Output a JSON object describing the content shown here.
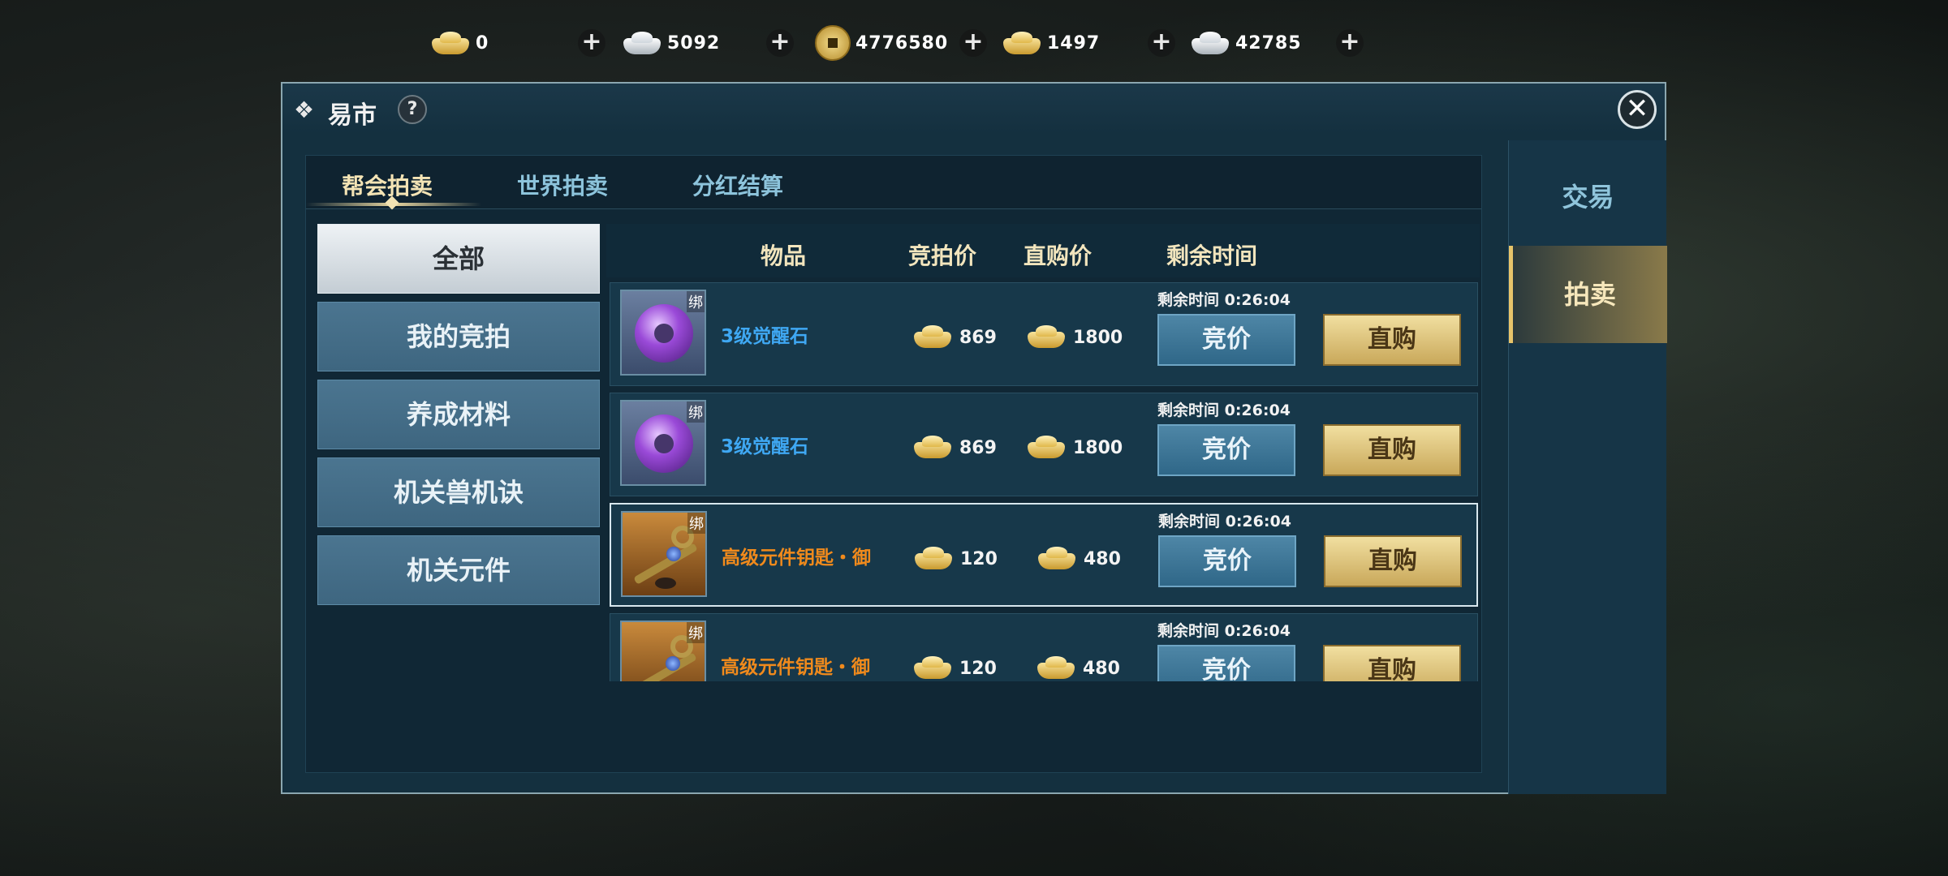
{
  "currencies": [
    {
      "type": "gold-ingot",
      "amount": "0"
    },
    {
      "type": "silver-ingot",
      "amount": "5092"
    },
    {
      "type": "copper-coin",
      "amount": "4776580"
    },
    {
      "type": "gold-ingot-small",
      "amount": "1497"
    },
    {
      "type": "silver-ingot-large",
      "amount": "42785"
    }
  ],
  "currency_plus": "+",
  "window": {
    "title": "易市",
    "help": "?",
    "close": "✕"
  },
  "tabs": [
    "帮会拍卖",
    "世界拍卖",
    "分红结算"
  ],
  "categories": [
    "全部",
    "我的竞拍",
    "养成材料",
    "机关兽机诀",
    "机关元件"
  ],
  "table_headers": {
    "item": "物品",
    "bid_price": "竞拍价",
    "buy_price": "直购价",
    "time_left": "剩余时间"
  },
  "rows": [
    {
      "name": "3级觉醒石",
      "icon": "awakening-stone",
      "bind": "绑",
      "bid": "869",
      "buy": "1800",
      "timer": "剩余时间  0:26:04",
      "bid_label": "竞价",
      "buy_label": "直购"
    },
    {
      "name": "3级觉醒石",
      "icon": "awakening-stone",
      "bind": "绑",
      "bid": "869",
      "buy": "1800",
      "timer": "剩余时间  0:26:04",
      "bid_label": "竞价",
      "buy_label": "直购"
    },
    {
      "name": "高级元件钥匙・御",
      "icon": "component-key",
      "bind": "绑",
      "bid": "120",
      "buy": "480",
      "timer": "剩余时间  0:26:04",
      "bid_label": "竞价",
      "buy_label": "直购"
    },
    {
      "name": "高级元件钥匙・御",
      "icon": "component-key",
      "bind": "绑",
      "bid": "120",
      "buy": "480",
      "timer": "剩余时间  0:26:04",
      "bid_label": "竞价",
      "buy_label": "直购"
    }
  ],
  "right_tabs": [
    "交易",
    "拍卖"
  ],
  "colors": {
    "accent_gold": "#f4e4b5",
    "item_blue": "#3fa8f3",
    "item_orange": "#f08a1c"
  }
}
